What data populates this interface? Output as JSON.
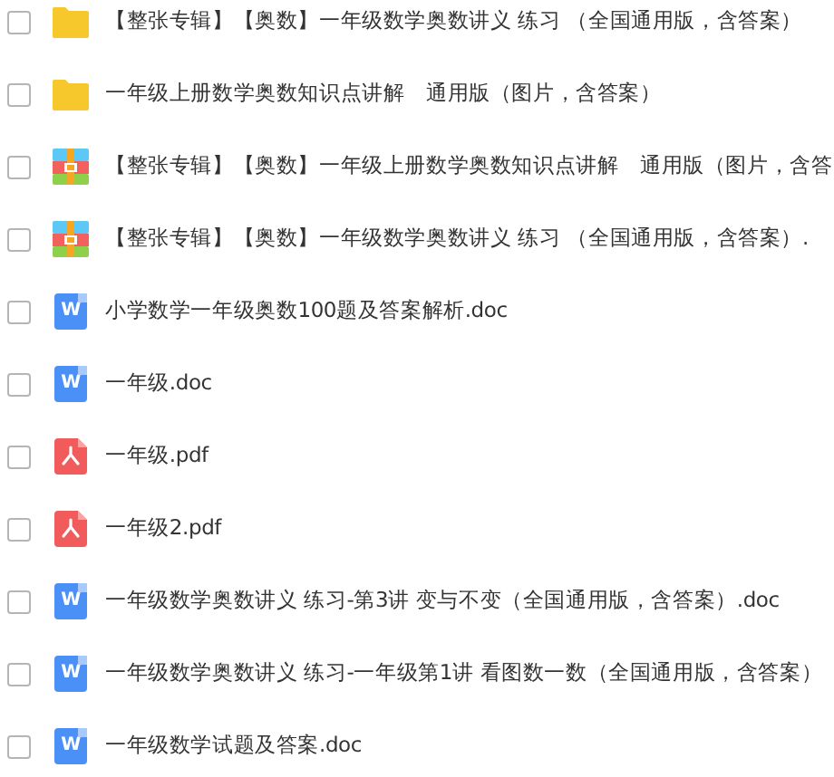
{
  "files": [
    {
      "kind": "folder",
      "checked": false,
      "name": "【整张专辑】【奥数】一年级数学奥数讲义 练习 （全国通用版，含答案）"
    },
    {
      "kind": "folder",
      "checked": false,
      "name": "一年级上册数学奥数知识点讲解　通用版（图片，含答案）"
    },
    {
      "kind": "zip",
      "checked": false,
      "name": "【整张专辑】【奥数】一年级上册数学奥数知识点讲解　通用版（图片，含答"
    },
    {
      "kind": "zip",
      "checked": false,
      "name": "【整张专辑】【奥数】一年级数学奥数讲义 练习 （全国通用版，含答案）."
    },
    {
      "kind": "word",
      "checked": false,
      "badge": "W",
      "name": "小学数学一年级奥数100题及答案解析.doc"
    },
    {
      "kind": "word",
      "checked": false,
      "badge": "W",
      "name": "一年级.doc"
    },
    {
      "kind": "pdf",
      "checked": false,
      "name": "一年级.pdf"
    },
    {
      "kind": "pdf",
      "checked": false,
      "name": "一年级2.pdf"
    },
    {
      "kind": "word",
      "checked": false,
      "badge": "W",
      "name": "一年级数学奥数讲义 练习-第3讲  变与不变（全国通用版，含答案）.doc"
    },
    {
      "kind": "word",
      "checked": false,
      "badge": "W",
      "name": "一年级数学奥数讲义 练习-一年级第1讲 看图数一数（全国通用版，含答案）"
    },
    {
      "kind": "word",
      "checked": false,
      "badge": "W",
      "name": "一年级数学试题及答案.doc"
    }
  ]
}
